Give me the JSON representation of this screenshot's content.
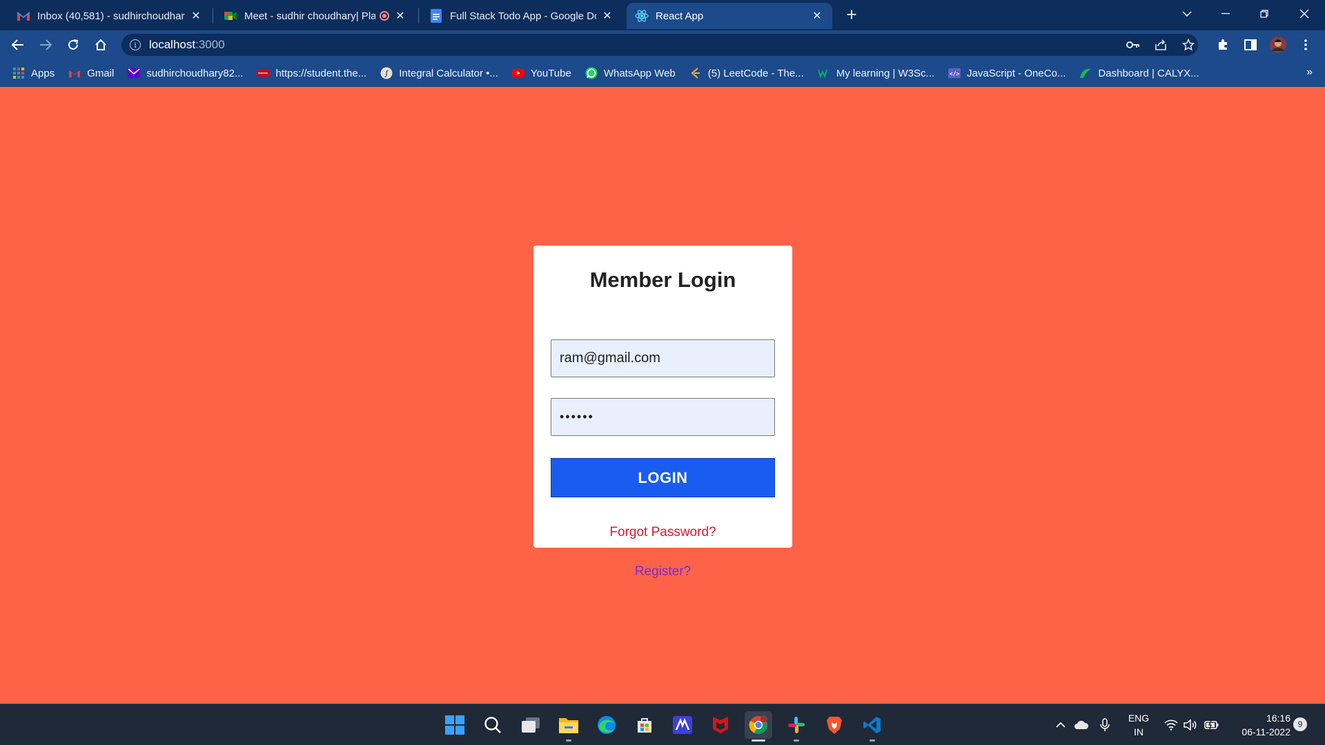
{
  "browser": {
    "tabs": [
      {
        "title": "Inbox (40,581) - sudhirchoudhary",
        "icon": "gmail-icon"
      },
      {
        "title": "Meet - sudhir choudhary| Pla",
        "icon": "google-meet-icon"
      },
      {
        "title": "Full Stack Todo App - Google Do",
        "icon": "google-docs-icon"
      },
      {
        "title": "React App",
        "icon": "react-icon",
        "active": true
      }
    ],
    "new_tab": "+",
    "address": {
      "host": "localhost",
      "port": ":3000"
    },
    "bookmarks": [
      {
        "label": "Apps",
        "icon": "apps-grid-icon"
      },
      {
        "label": "Gmail",
        "icon": "gmail-icon"
      },
      {
        "label": "sudhirchoudhary82...",
        "icon": "yahoo-mail-icon"
      },
      {
        "label": "https://student.the...",
        "icon": "student-portal-icon"
      },
      {
        "label": "Integral Calculator •...",
        "icon": "calculator-icon"
      },
      {
        "label": "YouTube",
        "icon": "youtube-icon"
      },
      {
        "label": "WhatsApp Web",
        "icon": "whatsapp-icon"
      },
      {
        "label": "(5) LeetCode - The...",
        "icon": "leetcode-icon"
      },
      {
        "label": "My learning | W3Sc...",
        "icon": "w3schools-icon"
      },
      {
        "label": "JavaScript - OneCo...",
        "icon": "onecompiler-icon"
      },
      {
        "label": "Dashboard | CALYX...",
        "icon": "calyx-icon"
      }
    ],
    "bookmarks_more": "»"
  },
  "login": {
    "title": "Member Login",
    "email_value": "ram@gmail.com",
    "password_value": "••••••",
    "button_label": "LOGIN",
    "forgot_label": "Forgot Password?",
    "register_label": "Register?"
  },
  "colors": {
    "page_bg": "#ff6347",
    "button_bg": "#1a5cf0",
    "forgot_link": "#e0162b",
    "register_link": "#7a2bd6",
    "input_bg": "#e8f0fe"
  },
  "taskbar": {
    "apps": [
      "windows-start-icon",
      "search-icon",
      "task-view-icon",
      "file-explorer-icon",
      "edge-icon",
      "microsoft-store-icon",
      "mathpix-icon",
      "mcafee-icon",
      "chrome-icon",
      "slack-icon",
      "brave-icon",
      "vscode-icon"
    ],
    "lang_line1": "ENG",
    "lang_line2": "IN",
    "time": "16:16",
    "date": "06-11-2022",
    "notifications": "9"
  }
}
